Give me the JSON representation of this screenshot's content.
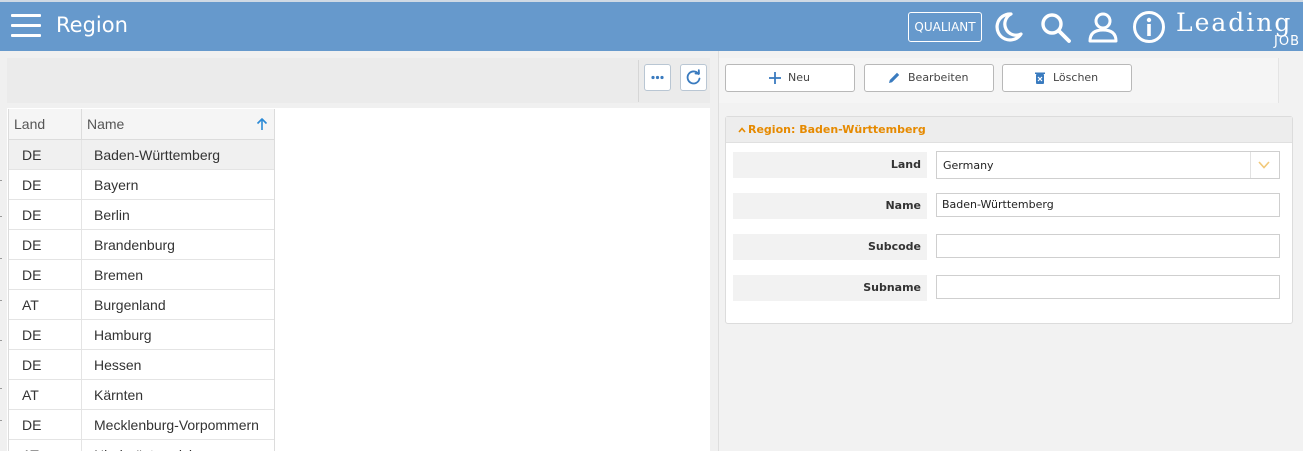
{
  "header": {
    "title": "Region",
    "qualiant_label": "QUALIANT",
    "logo_text": "Leading",
    "logo_sub": "JOB",
    "icons": [
      "menu-icon",
      "moon-icon",
      "search-icon",
      "user-icon",
      "info-icon"
    ],
    "color": "#6699cc"
  },
  "grid": {
    "columns": [
      "Land",
      "Name"
    ],
    "sort_column": "Name",
    "sort_direction": "ascending",
    "rows": [
      {
        "land": "DE",
        "name": "Baden-Württemberg",
        "selected": true
      },
      {
        "land": "DE",
        "name": "Bayern"
      },
      {
        "land": "DE",
        "name": "Berlin"
      },
      {
        "land": "DE",
        "name": "Brandenburg"
      },
      {
        "land": "DE",
        "name": "Bremen"
      },
      {
        "land": "AT",
        "name": "Burgenland"
      },
      {
        "land": "DE",
        "name": "Hamburg"
      },
      {
        "land": "DE",
        "name": "Hessen"
      },
      {
        "land": "AT",
        "name": "Kärnten"
      },
      {
        "land": "DE",
        "name": "Mecklenburg-Vorpommern"
      },
      {
        "land": "AT",
        "name": "Niederösterreich"
      }
    ]
  },
  "left_toolbar": {
    "icons": [
      "more-icon",
      "refresh-icon"
    ]
  },
  "actions": {
    "new_label": "Neu",
    "edit_label": "Bearbeiten",
    "delete_label": "Löschen",
    "accent": "#3a7bbf"
  },
  "form": {
    "header": "Region: Baden-Württemberg",
    "header_color": "#e68a00",
    "fields": [
      {
        "label": "Land",
        "value": "Germany",
        "type": "select"
      },
      {
        "label": "Name",
        "value": "Baden-Württemberg",
        "type": "text"
      },
      {
        "label": "Subcode",
        "value": "",
        "type": "text"
      },
      {
        "label": "Subname",
        "value": "",
        "type": "text"
      }
    ]
  }
}
